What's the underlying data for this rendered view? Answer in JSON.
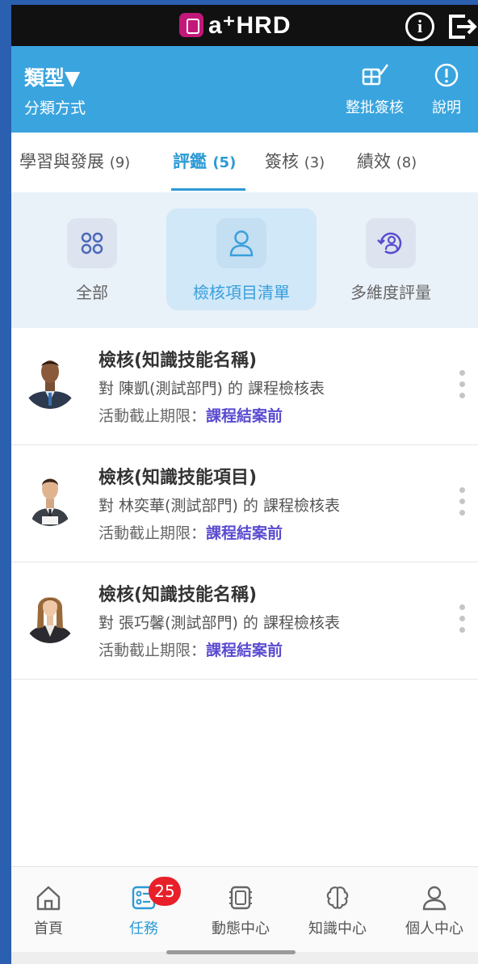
{
  "app": {
    "name": "a⁺HRD"
  },
  "header": {
    "type_title": "類型▼",
    "type_subtitle": "分類方式",
    "batch_label": "整批簽核",
    "help_label": "說明"
  },
  "tabs": [
    {
      "label": "學習與發展",
      "count": "(9)"
    },
    {
      "label": "評鑑",
      "count": "(5)"
    },
    {
      "label": "簽核",
      "count": "(3)"
    },
    {
      "label": "績效",
      "count": "(8)"
    }
  ],
  "active_tab": 1,
  "categories": [
    {
      "label": "全部",
      "icon": "grid-icon"
    },
    {
      "label": "檢核項目清單",
      "icon": "person-icon"
    },
    {
      "label": "多維度評量",
      "icon": "person-cycle-icon"
    }
  ],
  "active_category": 1,
  "items": [
    {
      "title": "檢核(知識技能名稱)",
      "desc": "對 陳凱(測試部門) 的 課程檢核表",
      "deadline_label": "活動截止期限：",
      "deadline_value": "課程結案前"
    },
    {
      "title": "檢核(知識技能項目)",
      "desc": "對 林奕華(測試部門) 的 課程檢核表",
      "deadline_label": "活動截止期限：",
      "deadline_value": "課程結案前"
    },
    {
      "title": "檢核(知識技能名稱)",
      "desc": "對 張巧馨(測試部門) 的 課程檢核表",
      "deadline_label": "活動截止期限：",
      "deadline_value": "課程結案前"
    }
  ],
  "bottom_nav": [
    {
      "label": "首頁",
      "icon": "home-icon"
    },
    {
      "label": "任務",
      "icon": "task-icon",
      "badge": "25"
    },
    {
      "label": "動態中心",
      "icon": "activity-icon"
    },
    {
      "label": "知識中心",
      "icon": "brain-icon"
    },
    {
      "label": "個人中心",
      "icon": "profile-icon"
    }
  ],
  "active_nav": 1,
  "colors": {
    "header_blue": "#3aa4de",
    "accent": "#2b9ad6",
    "deadline": "#5a4bd0",
    "badge_red": "#e8202a"
  }
}
